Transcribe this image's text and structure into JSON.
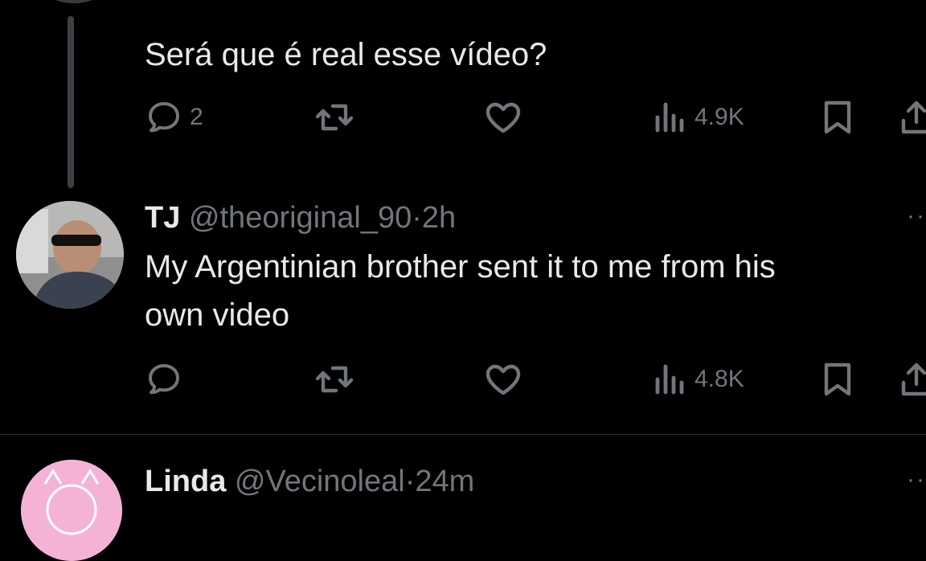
{
  "parent_tweet": {
    "text": "Será que é real esse vídeo?",
    "actions": {
      "replies": "2",
      "views": "4.9K"
    }
  },
  "reply_tweet": {
    "name": "TJ",
    "handle": "@theoriginal_90",
    "separator": "·",
    "time": "2h",
    "text_line1": "My Argentinian brother sent it to me from his",
    "text_line2": "own video",
    "actions": {
      "views": "4.8K"
    },
    "more": "··"
  },
  "next_tweet": {
    "name": "Linda",
    "handle": "@Vecinoleal",
    "separator": "·",
    "time": "24m",
    "more": "··"
  },
  "colors": {
    "background": "#000000",
    "text": "#e7e9ea",
    "muted": "#71767b",
    "thread_line": "#3e4144"
  },
  "icons": [
    "reply-icon",
    "retweet-icon",
    "like-icon",
    "views-icon",
    "bookmark-icon",
    "share-icon",
    "more-icon"
  ]
}
